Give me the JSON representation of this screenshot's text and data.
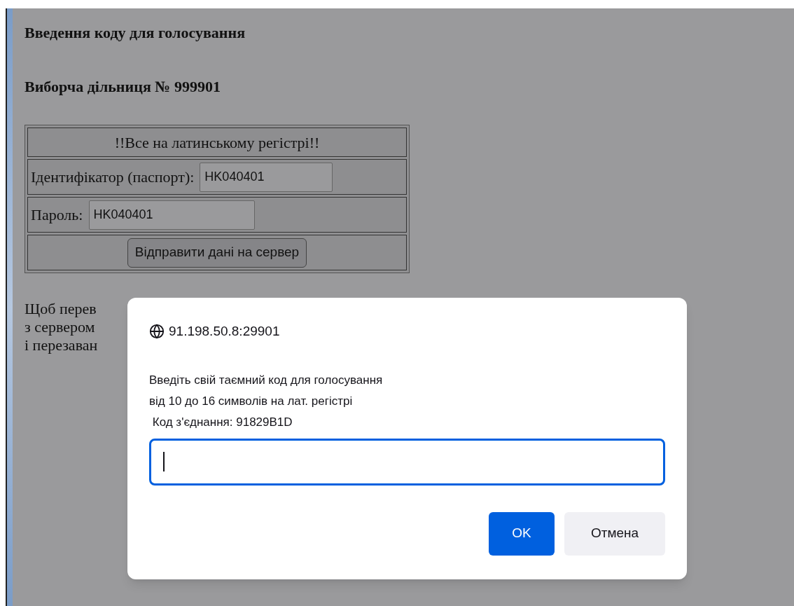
{
  "page": {
    "headings": [
      "Введення коду для голосування",
      "Виборча дільниця № 999901"
    ],
    "form": {
      "notice": "!!Все на латинському регістрі!!",
      "fields": [
        {
          "label": "Ідентифікатор (паспорт):",
          "value": "HK040401"
        },
        {
          "label": "Пароль:",
          "value": "HK040401"
        }
      ],
      "submit_button": "Відправити дані на сервер"
    },
    "paragraph_lines": [
      "Щоб перев",
      "з сервером",
      "і перезаван"
    ]
  },
  "dialog": {
    "origin": "91.198.50.8:29901",
    "message_lines": [
      "Введіть свій таємний код для голосування",
      "від 10 до 16 символів на лат. регістрі",
      " Код з'єднання: 91829B1D"
    ],
    "input": {
      "focused": true
    },
    "buttons": [
      {
        "label": "OK",
        "kind": "primary"
      },
      {
        "label": "Отмена",
        "kind": "secondary"
      }
    ]
  }
}
